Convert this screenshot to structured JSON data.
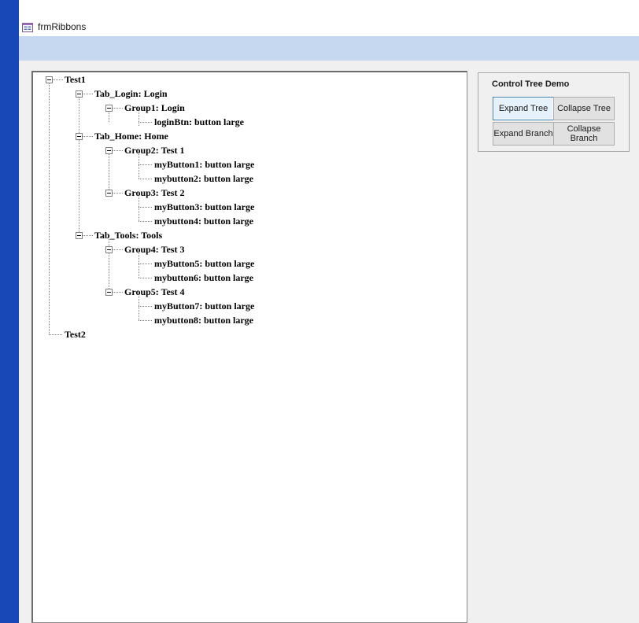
{
  "window": {
    "title": "frmRibbons"
  },
  "panel": {
    "title": "Control Tree Demo",
    "buttons": {
      "expand_tree": "Expand Tree",
      "collapse_tree": "Collapse Tree",
      "expand_branch": "Expand Branch",
      "collapse_branch": "Collapse Branch"
    }
  },
  "tree": {
    "nodes": [
      "Test1",
      "Tab_Login: Login",
      "Group1: Login",
      "loginBtn: button large",
      "Tab_Home: Home",
      "Group2: Test 1",
      "myButton1: button large",
      "mybutton2: button large",
      "Group3: Test 2",
      "myButton3: button large",
      "mybutton4: button large",
      "Tab_Tools: Tools",
      "Group4: Test 3",
      "myButton5: button large",
      "mybutton6: button large",
      "Group5: Test 4",
      "myButton7: button large",
      "mybutton8: button large",
      "Test2"
    ]
  },
  "colors": {
    "accent_strip": "#1848b8",
    "header_band": "#c6d8f0",
    "focus_border": "#3c7fb1"
  }
}
